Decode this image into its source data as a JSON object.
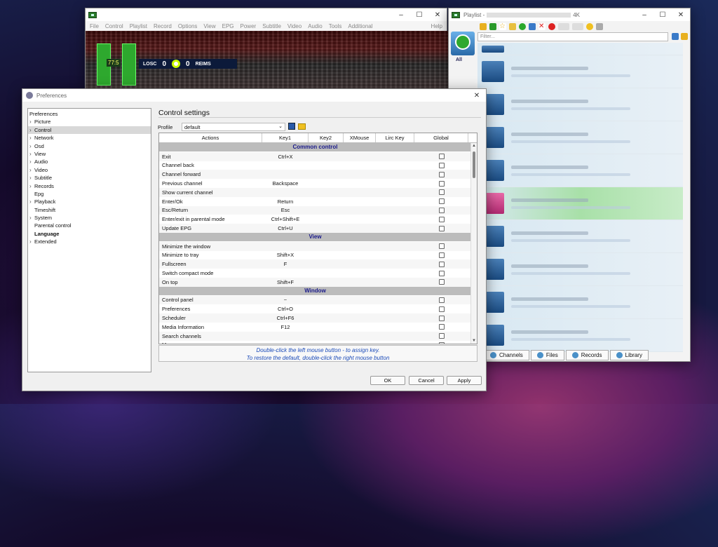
{
  "main_window": {
    "menu": [
      "File",
      "Control",
      "Playlist",
      "Record",
      "Options",
      "View",
      "EPG",
      "Power",
      "Subtitle",
      "Video",
      "Audio",
      "Tools",
      "Additional"
    ],
    "help": "Help",
    "scoreboard": {
      "clock": "77:5",
      "home": "LOSC",
      "home_score": "0",
      "away_score": "0",
      "away": "REIMS"
    }
  },
  "playlist": {
    "title": "Playlist -",
    "title_suffix": "4K",
    "filter_placeholder": "Filter...",
    "all_label": "All",
    "tabs": [
      {
        "label": "Channels",
        "icon": "channels-icon"
      },
      {
        "label": "Files",
        "icon": "files-icon"
      },
      {
        "label": "Records",
        "icon": "records-icon"
      },
      {
        "label": "Library",
        "icon": "library-icon"
      }
    ]
  },
  "prefs": {
    "title": "Preferences",
    "tree": [
      {
        "label": "Preferences",
        "expandable": false,
        "root": true
      },
      {
        "label": "Picture",
        "expandable": true
      },
      {
        "label": "Control",
        "expandable": true,
        "selected": true
      },
      {
        "label": "Network",
        "expandable": true
      },
      {
        "label": "Osd",
        "expandable": true
      },
      {
        "label": "View",
        "expandable": true
      },
      {
        "label": "Audio",
        "expandable": true
      },
      {
        "label": "Video",
        "expandable": true
      },
      {
        "label": "Subtitle",
        "expandable": true
      },
      {
        "label": "Records",
        "expandable": true
      },
      {
        "label": "Epg",
        "expandable": false
      },
      {
        "label": "Playback",
        "expandable": true
      },
      {
        "label": "Timeshift",
        "expandable": false
      },
      {
        "label": "System",
        "expandable": true
      },
      {
        "label": "Parental control",
        "expandable": false
      },
      {
        "label": "Language",
        "expandable": false,
        "bold": true
      },
      {
        "label": "Extended",
        "expandable": true
      }
    ],
    "panel_title": "Control settings",
    "profile_label": "Profile",
    "profile_value": "default",
    "columns": [
      "Actions",
      "Key1",
      "Key2",
      "XMouse",
      "Lirc Key",
      "Global"
    ],
    "sections": [
      {
        "title": "Common control",
        "rows": [
          {
            "action": "Exit",
            "key1": "Ctrl+X"
          },
          {
            "action": "Channel back",
            "key1": ""
          },
          {
            "action": "Channel forward",
            "key1": ""
          },
          {
            "action": "Previous channel",
            "key1": "Backspace"
          },
          {
            "action": "Show current channel",
            "key1": ""
          },
          {
            "action": "Enter/Ok",
            "key1": "Return"
          },
          {
            "action": "Esc/Return",
            "key1": "Esc"
          },
          {
            "action": "Enter/exit in parental mode",
            "key1": "Ctrl+Shift+E"
          },
          {
            "action": "Update EPG",
            "key1": "Ctrl+U"
          }
        ]
      },
      {
        "title": "View",
        "rows": [
          {
            "action": "Minimize the window",
            "key1": ""
          },
          {
            "action": "Minimize to tray",
            "key1": "Shift+X"
          },
          {
            "action": "Fullscreen",
            "key1": "F"
          },
          {
            "action": "Switch compact mode",
            "key1": ""
          },
          {
            "action": "On top",
            "key1": "Shift+F"
          }
        ]
      },
      {
        "title": "Window",
        "rows": [
          {
            "action": "Control panel",
            "key1": "~"
          },
          {
            "action": "Preferences",
            "key1": "Ctrl+O"
          },
          {
            "action": "Scheduler",
            "key1": "Ctrl+F6"
          },
          {
            "action": "Media Information",
            "key1": "F12"
          },
          {
            "action": "Search channels",
            "key1": ""
          },
          {
            "action": "M...",
            "key1": ""
          }
        ]
      }
    ],
    "hint_line1": "Double-click the left mouse button - to assign key.",
    "hint_line2": "To restore the default, double-click the right mouse button",
    "buttons": {
      "ok": "OK",
      "cancel": "Cancel",
      "apply": "Apply"
    }
  }
}
